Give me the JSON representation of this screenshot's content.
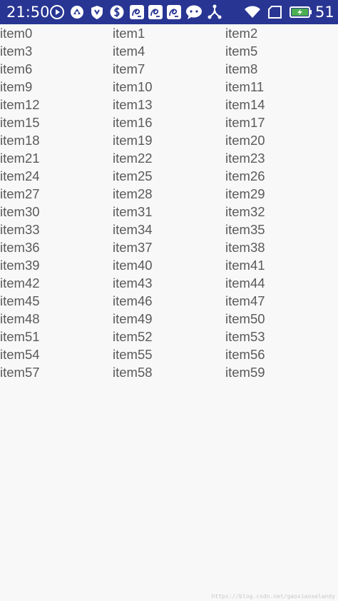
{
  "status_bar": {
    "time": "21:50",
    "battery_percent": "51",
    "icons": [
      "play-circle-icon",
      "sync-icon",
      "shield-icon",
      "money-icon",
      "uc-browser-icon",
      "uc-browser-icon",
      "uc-browser-icon",
      "chat-bubble-icon",
      "network-share-icon",
      "wifi-icon",
      "sim-icon",
      "battery-charging-icon"
    ],
    "background_color": "#283593"
  },
  "grid": {
    "items": [
      "item0",
      "item1",
      "item2",
      "item3",
      "item4",
      "item5",
      "item6",
      "item7",
      "item8",
      "item9",
      "item10",
      "item11",
      "item12",
      "item13",
      "item14",
      "item15",
      "item16",
      "item17",
      "item18",
      "item19",
      "item20",
      "item21",
      "item22",
      "item23",
      "item24",
      "item25",
      "item26",
      "item27",
      "item28",
      "item29",
      "item30",
      "item31",
      "item32",
      "item33",
      "item34",
      "item35",
      "item36",
      "item37",
      "item38",
      "item39",
      "item40",
      "item41",
      "item42",
      "item43",
      "item44",
      "item45",
      "item46",
      "item47",
      "item48",
      "item49",
      "item50",
      "item51",
      "item52",
      "item53",
      "item54",
      "item55",
      "item56",
      "item57",
      "item58",
      "item59"
    ]
  },
  "watermark": "https://blog.csdn.net/gaoxiaoxelandy"
}
